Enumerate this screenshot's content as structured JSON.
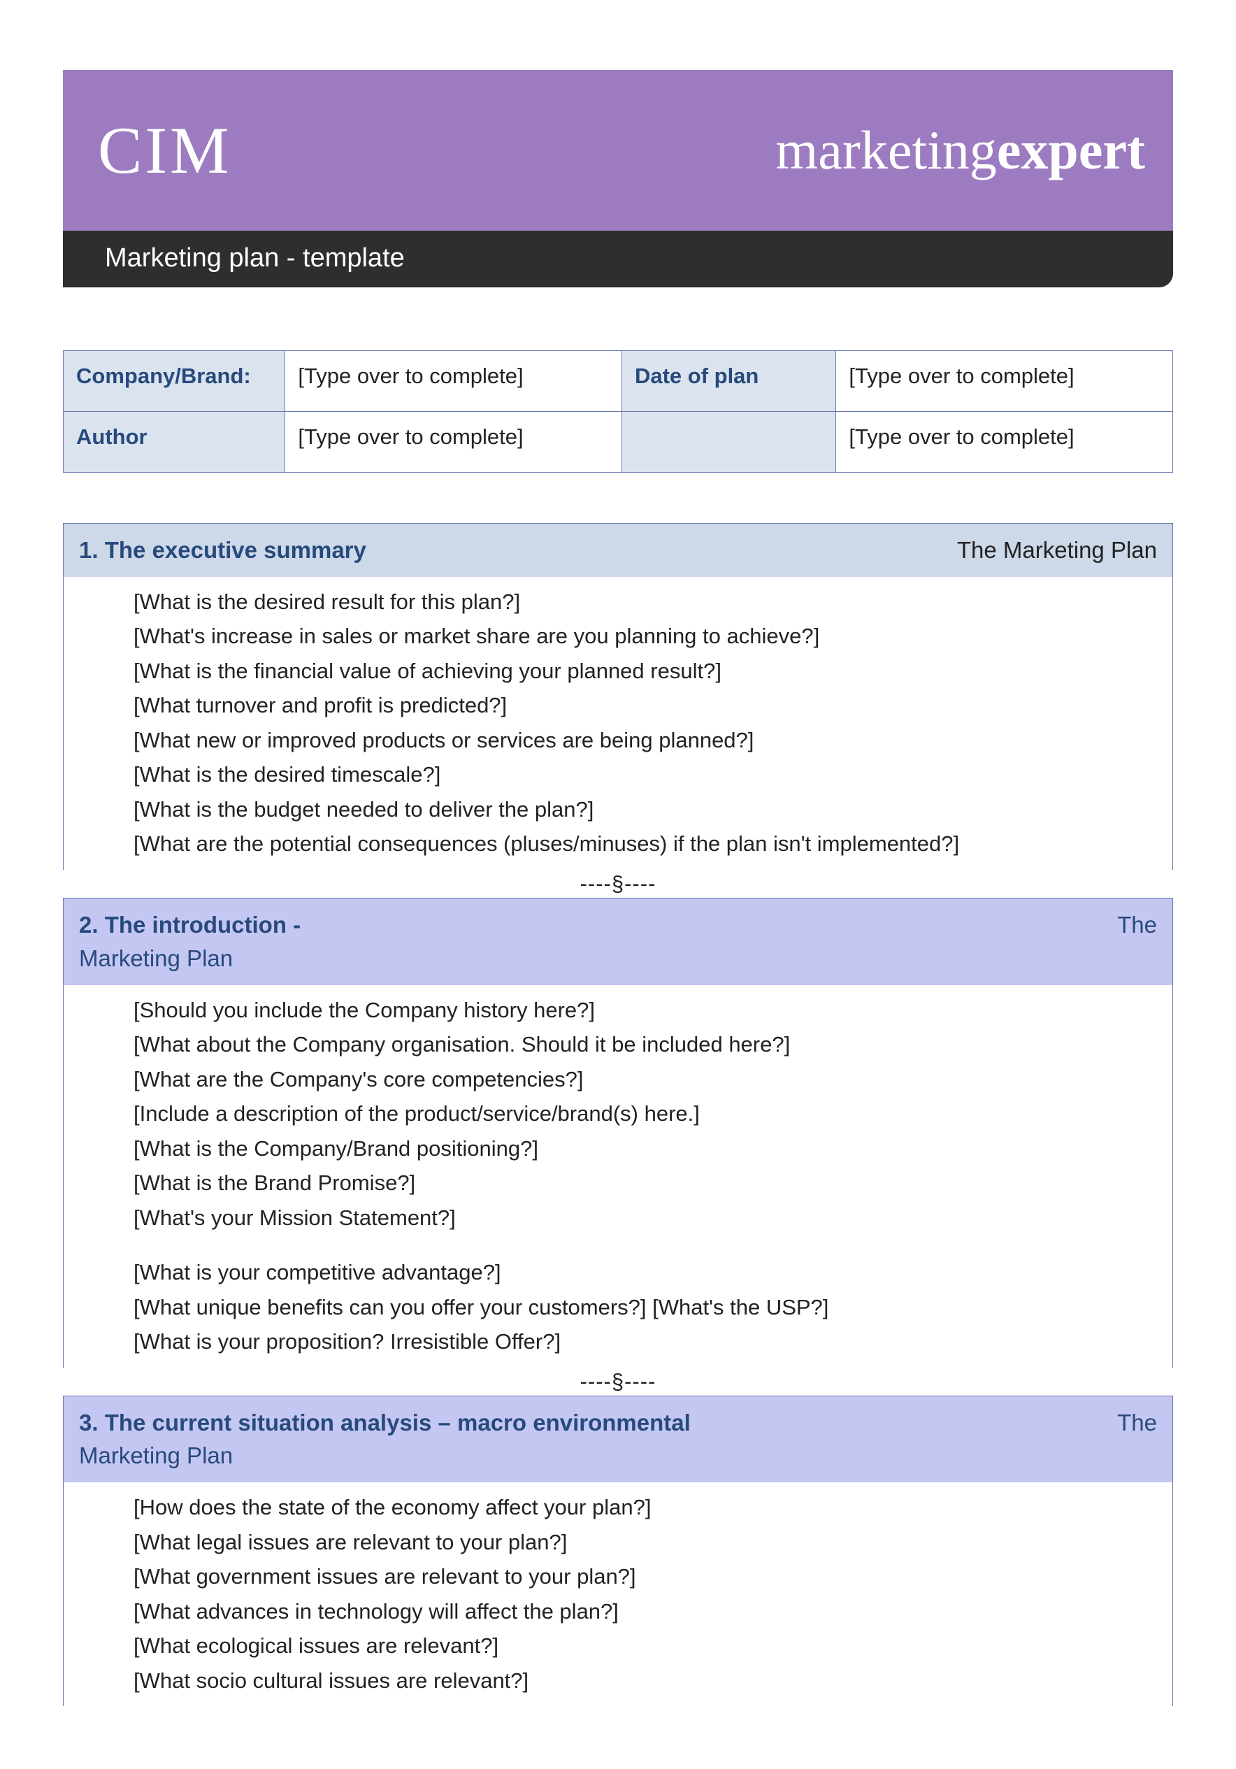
{
  "header": {
    "logo": "CIM",
    "brand_light": "marketing",
    "brand_bold": "expert",
    "subtitle": "Marketing plan - template"
  },
  "info": {
    "company_label": "Company/Brand:",
    "company_value": "[Type over to complete]",
    "date_label": "Date of plan",
    "date_value": "[Type over to complete]",
    "author_label": "Author",
    "author_value": "[Type over to complete]",
    "blank_label": "",
    "blank_value": "[Type over to complete]"
  },
  "sections": {
    "s1": {
      "num_title": "1.  The executive summary",
      "right": "The Marketing Plan",
      "items": [
        "[What is the desired result for this plan?]",
        "[What's increase in sales or market share are you planning to achieve?]",
        "[What is the financial value of achieving your planned result?]",
        "[What turnover and profit is predicted?]",
        "[What new or improved products or services are being planned?]",
        "[What is the desired timescale?]",
        "[What is the budget needed to deliver the plan?]",
        "[What are the potential consequences (pluses/minuses) if the plan isn't implemented?]"
      ]
    },
    "s2": {
      "num_title": "2.  The introduction -",
      "right": "The",
      "sub": "Marketing Plan",
      "items_a": [
        "[Should you include the Company history here?]",
        "[What about the Company organisation.  Should it be included here?]",
        "[What are the Company's core competencies?]",
        "[Include a description of the product/service/brand(s) here.]",
        "[What is the Company/Brand positioning?]",
        "[What is the Brand Promise?]",
        "[What's your Mission Statement?]"
      ],
      "items_b": [
        "[What is your competitive advantage?]",
        "[What unique benefits can you offer your customers?]  [What's the USP?]",
        "[What is your proposition? Irresistible Offer?]"
      ]
    },
    "s3": {
      "num_title": "3. The current situation analysis – macro environmental",
      "right": "The",
      "sub": "Marketing Plan",
      "items": [
        "[How does the state of the economy affect your plan?]",
        "[What legal issues are relevant to your plan?]",
        "[What government issues are relevant to your plan?]",
        "[What advances in technology will affect the plan?]",
        "[What ecological issues are relevant?]",
        "[What socio cultural issues are relevant?]"
      ]
    }
  },
  "separator": "----§----"
}
